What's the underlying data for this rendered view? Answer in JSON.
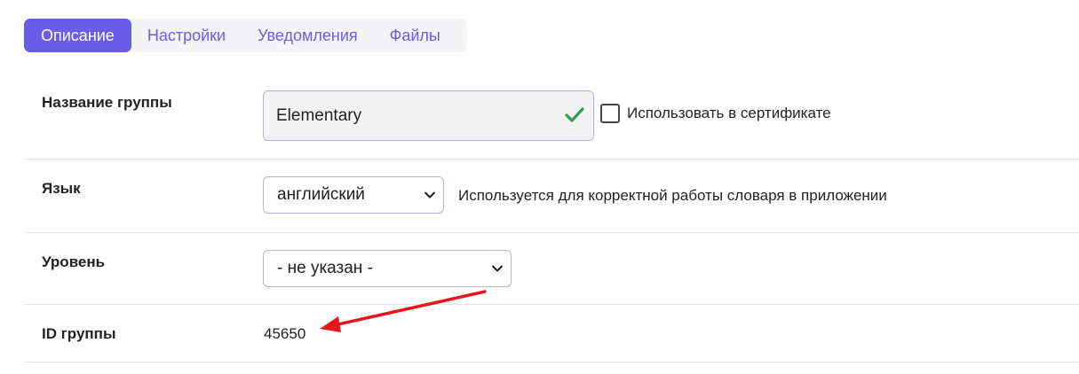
{
  "tabs": [
    {
      "label": "Описание",
      "active": true
    },
    {
      "label": "Настройки",
      "active": false
    },
    {
      "label": "Уведомления",
      "active": false
    },
    {
      "label": "Файлы",
      "active": false
    }
  ],
  "group_name": {
    "label": "Название группы",
    "value": "Elementary",
    "valid_icon": "check-icon",
    "use_in_certificate_label": "Использовать в сертификате",
    "use_in_certificate_checked": false
  },
  "language": {
    "label": "Язык",
    "selected": "английский",
    "hint": "Используется для корректной работы словаря в приложении"
  },
  "level": {
    "label": "Уровень",
    "selected": "- не указан -"
  },
  "group_id": {
    "label": "ID группы",
    "value": "45650"
  },
  "colors": {
    "accent": "#6b5ce7",
    "check": "#2e9e4f",
    "annotation_arrow": "#e8141b"
  }
}
